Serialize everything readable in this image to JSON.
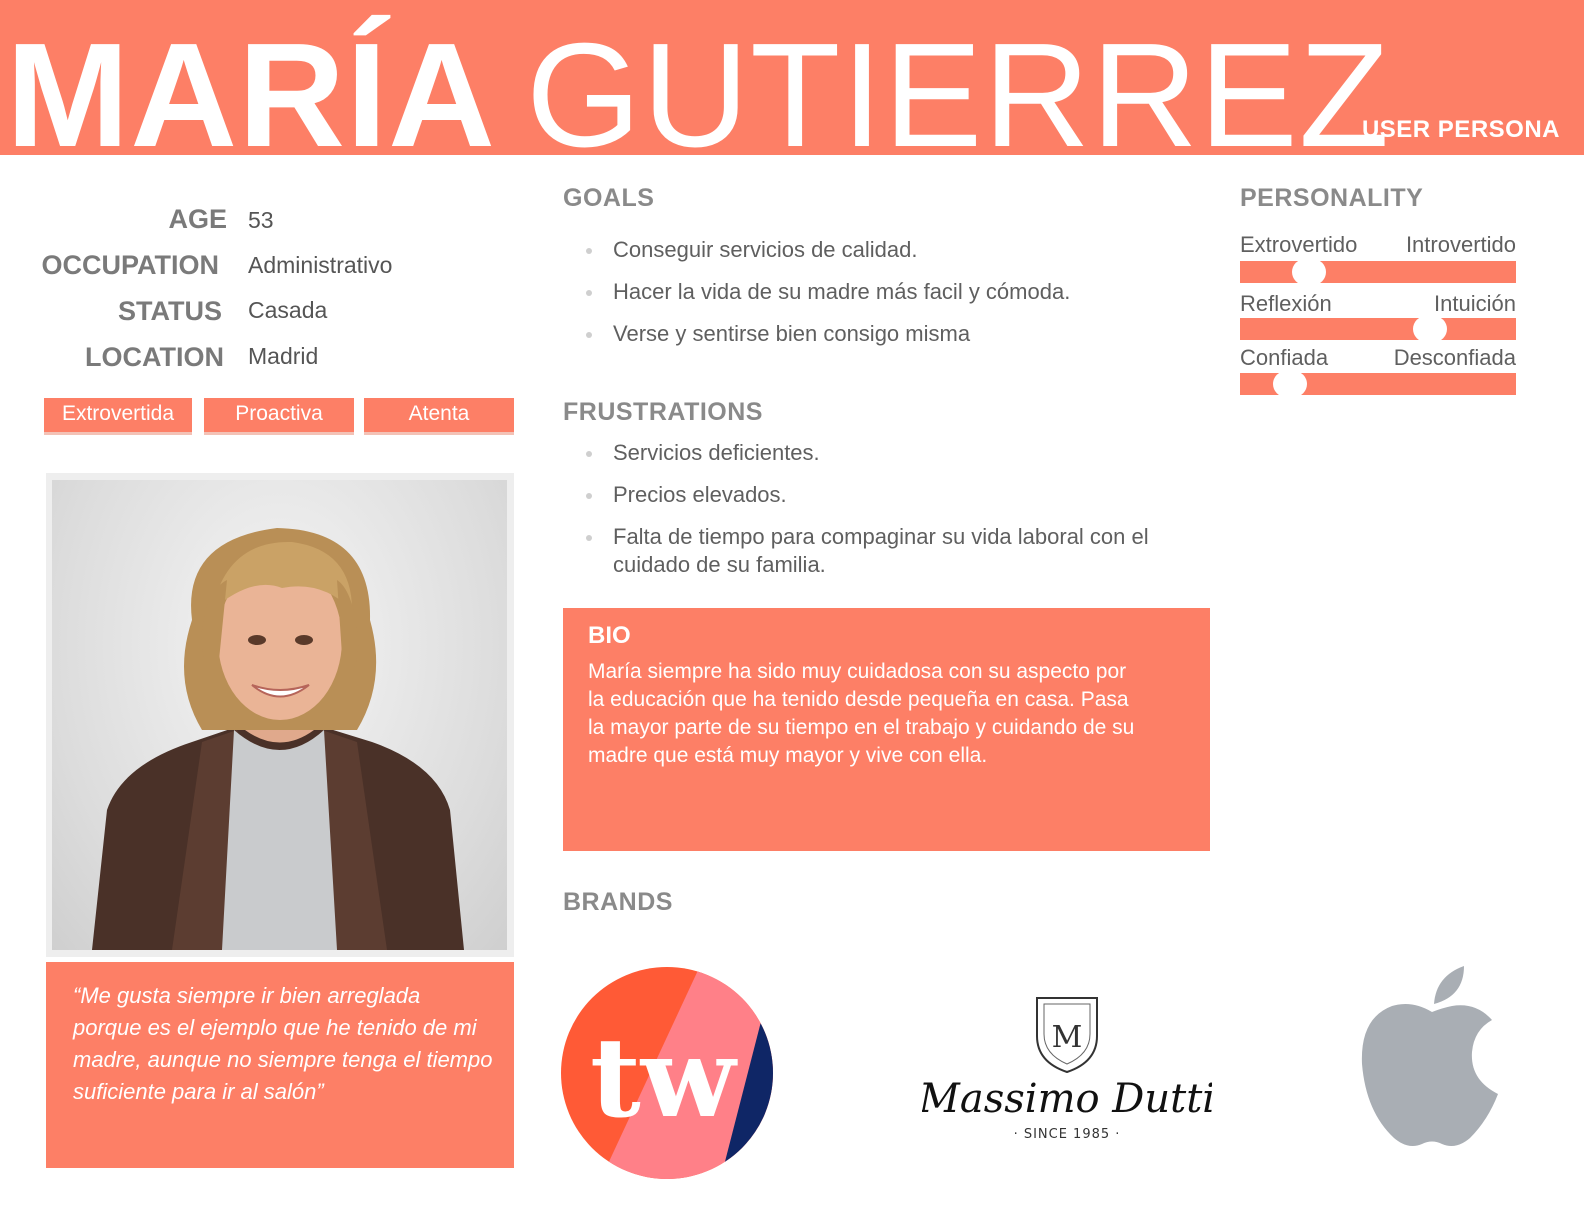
{
  "header": {
    "first_name": "MARÍA",
    "last_name": "GUTIERREZ",
    "doc_type": "USER PERSONA",
    "accent_color": "#fd7f66"
  },
  "info": [
    {
      "label": "AGE",
      "value": "53"
    },
    {
      "label": "OCCUPATION",
      "value": "Administrativo"
    },
    {
      "label": "STATUS",
      "value": "Casada"
    },
    {
      "label": "LOCATION",
      "value": "Madrid"
    }
  ],
  "traits": [
    "Extrovertida",
    "Proactiva",
    "Atenta"
  ],
  "quote": "“Me gusta siempre ir bien arreglada porque es el ejemplo que he tenido de mi madre, aunque no siempre tenga el tiempo suficiente para ir al salón”",
  "goals": {
    "title": "GOALS",
    "items": [
      "Conseguir servicios de calidad.",
      "Hacer la vida de su madre más facil y cómoda.",
      "Verse y sentirse bien consigo misma"
    ]
  },
  "frustrations": {
    "title": "FRUSTRATIONS",
    "items": [
      "Servicios deficientes.",
      "Precios elevados.",
      "Falta de tiempo para compaginar su vida laboral con el cuidado de su familia."
    ]
  },
  "bio": {
    "title": "BIO",
    "text": "María siempre ha sido muy cuidadosa con su aspecto por la educación que ha tenido desde pequeña en casa. Pasa la mayor parte de su tiempo en el trabajo y cuidando de su madre que está muy mayor y vive con ella."
  },
  "personality": {
    "title": "PERSONALITY",
    "scales": [
      {
        "left": "Extrovertido",
        "right": "Introvertido",
        "value": 0.25
      },
      {
        "left": "Reflexión",
        "right": "Intuición",
        "value": 0.69
      },
      {
        "left": "Confiada",
        "right": "Desconfiada",
        "value": 0.18
      }
    ]
  },
  "brands": {
    "title": "BRANDS",
    "items": [
      {
        "name": "tw-logo",
        "text": "tw"
      },
      {
        "name": "massimo-dutti-logo",
        "text": "Massimo Dutti",
        "subtext": "· SINCE 1985 ·"
      },
      {
        "name": "apple-logo"
      }
    ]
  }
}
